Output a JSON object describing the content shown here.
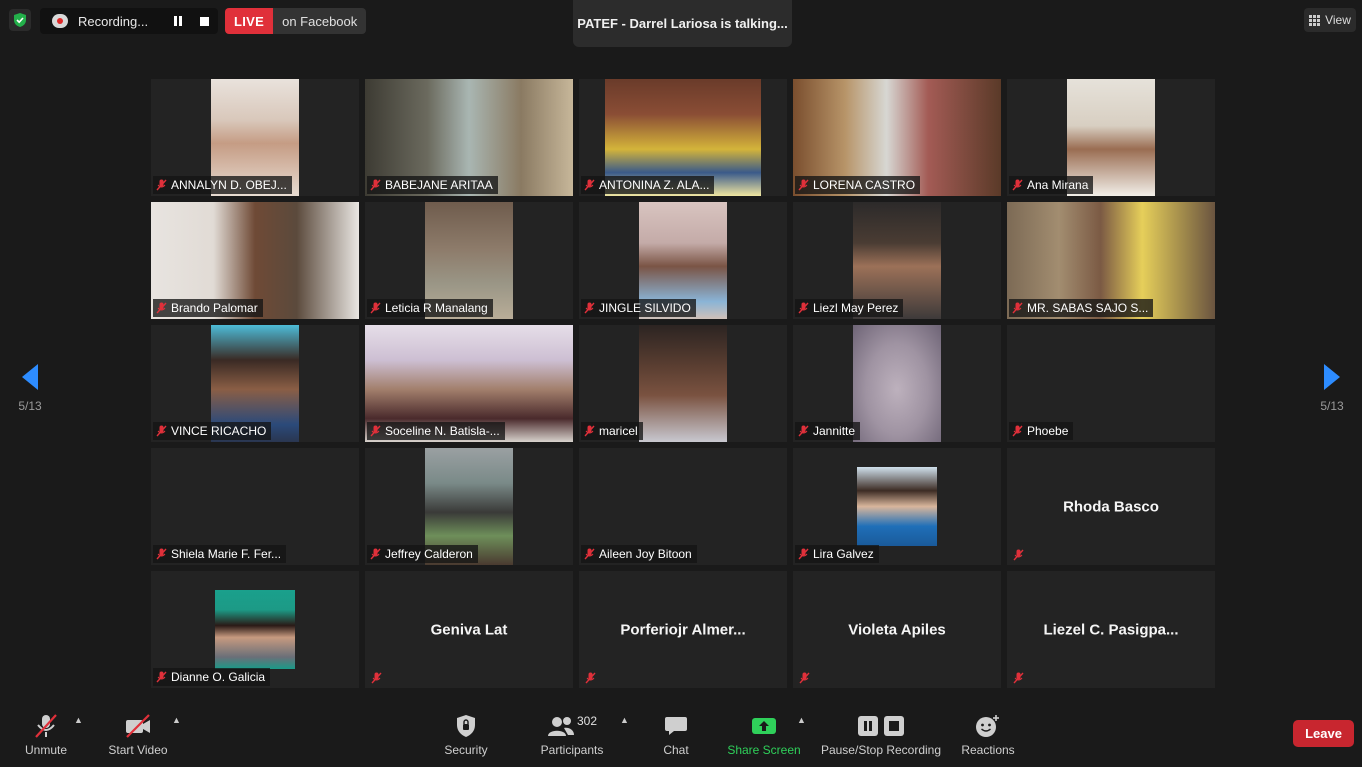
{
  "top_bar": {
    "recording_label": "Recording...",
    "live_label": "LIVE",
    "live_destination": "on Facebook",
    "talking_indicator": "PATEF - Darrel Lariosa is talking...",
    "view_label": "View"
  },
  "pagination": {
    "left_count": "5/13",
    "right_count": "5/13"
  },
  "participants": [
    {
      "name": "ANNALYN D. OBEJ...",
      "video": true,
      "muted": true
    },
    {
      "name": "BABEJANE ARITAA",
      "video": true,
      "muted": true
    },
    {
      "name": "ANTONINA Z. ALA...",
      "video": true,
      "muted": true
    },
    {
      "name": "LORENA CASTRO",
      "video": true,
      "muted": true
    },
    {
      "name": "Ana Mirana",
      "video": true,
      "muted": true
    },
    {
      "name": "Brando Palomar",
      "video": true,
      "muted": true
    },
    {
      "name": "Leticia R Manalang",
      "video": true,
      "muted": true
    },
    {
      "name": "JINGLE SILVIDO",
      "video": true,
      "muted": true
    },
    {
      "name": "Liezl May Perez",
      "video": true,
      "muted": true
    },
    {
      "name": "MR. SABAS SAJO S...",
      "video": true,
      "muted": true
    },
    {
      "name": "VINCE RICACHO",
      "video": true,
      "muted": true
    },
    {
      "name": "Soceline N. Batisla-...",
      "video": true,
      "muted": true
    },
    {
      "name": "maricel",
      "video": true,
      "muted": true
    },
    {
      "name": "Jannitte",
      "video": true,
      "muted": true
    },
    {
      "name": "Phoebe",
      "video": false,
      "muted": true
    },
    {
      "name": "Shiela Marie F. Fer...",
      "video": false,
      "muted": true
    },
    {
      "name": "Jeffrey Calderon",
      "video": true,
      "muted": true
    },
    {
      "name": "Aileen Joy Bitoon",
      "video": false,
      "muted": true
    },
    {
      "name": "Lira Galvez",
      "video": true,
      "muted": true
    },
    {
      "name": "Rhoda Basco",
      "video": false,
      "muted": true,
      "centered": true
    },
    {
      "name": "Dianne O. Galicia",
      "video": true,
      "muted": true
    },
    {
      "name": "Geniva Lat",
      "video": false,
      "muted": true,
      "centered": true
    },
    {
      "name": "Porferiojr  Almer...",
      "video": false,
      "muted": true,
      "centered": true
    },
    {
      "name": "Violeta Apiles",
      "video": false,
      "muted": true,
      "centered": true
    },
    {
      "name": "Liezel  C.  Pasigpa...",
      "video": false,
      "muted": true,
      "centered": true
    }
  ],
  "toolbar": {
    "unmute_label": "Unmute",
    "start_video_label": "Start Video",
    "security_label": "Security",
    "participants_label": "Participants",
    "participants_count": "302",
    "chat_label": "Chat",
    "share_screen_label": "Share Screen",
    "recording_label": "Pause/Stop Recording",
    "reactions_label": "Reactions",
    "leave_label": "Leave"
  },
  "colors": {
    "live": "#e0303a",
    "share": "#2fd05a",
    "leave": "#c8262f",
    "muted": "#e0303a"
  }
}
